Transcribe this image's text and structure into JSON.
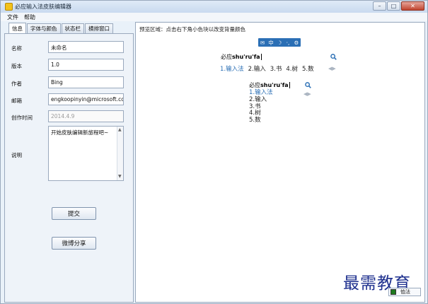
{
  "window": {
    "title": "必应输入法皮肤编辑器",
    "controls": {
      "minimize": "–",
      "maximize": "□",
      "close": "✕"
    }
  },
  "menu": [
    {
      "label": "文件"
    },
    {
      "label": "帮助"
    }
  ],
  "tabs": [
    {
      "label": "信息",
      "active": true
    },
    {
      "label": "字体与颜色",
      "active": false
    },
    {
      "label": "状态栏",
      "active": false
    },
    {
      "label": "横排窗口",
      "active": false
    }
  ],
  "form": {
    "name_label": "名称",
    "name_value": "未命名",
    "version_label": "版本",
    "version_value": "1.0",
    "author_label": "作者",
    "author_value": "Bing",
    "email_label": "邮箱",
    "email_value": "engkoopinyin@microsoft.com",
    "created_label": "创作时间",
    "created_value": "2014.4.9",
    "desc_label": "说明",
    "desc_value": "开始皮肤编辑新旅程吧~"
  },
  "buttons": {
    "submit": "提交",
    "share": "微博分享"
  },
  "preview": {
    "caption": "预览区域：点击右下角小色块以改变背量颜色",
    "status_bar": [
      "✉",
      "中",
      "☽",
      "·,",
      "⚙"
    ],
    "composition_prefix": "必应",
    "composition_pinyin": "shu'ru'fa",
    "candidates": [
      {
        "text": "1.输入法",
        "highlighted": true
      },
      {
        "text": "2.输入",
        "highlighted": false
      },
      {
        "text": "3.书",
        "highlighted": false
      },
      {
        "text": "4.树",
        "highlighted": false
      },
      {
        "text": "5.数",
        "highlighted": false
      }
    ],
    "pager": "◀▶",
    "color_label": "恤法"
  },
  "watermark": "最需教育",
  "colors": {
    "accent": "#2b6fb5",
    "swatch": "#1e7a1e",
    "watermark": "#1d2f8e"
  }
}
